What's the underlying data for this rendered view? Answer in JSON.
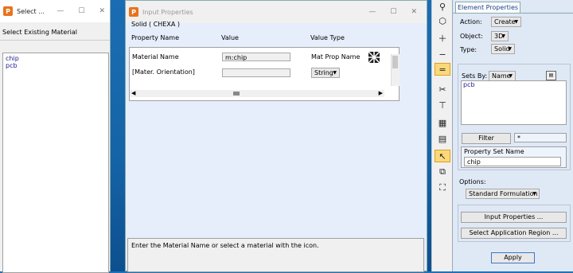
{
  "select_window": {
    "title": "Select ...",
    "instruction": "Select Existing Material",
    "items": [
      "chip",
      "pcb"
    ]
  },
  "input_window": {
    "title": "Input Properties",
    "solid_label": "Solid  ( CHEXA )",
    "col_name": "Property Name",
    "col_value": "Value",
    "col_type": "Value Type",
    "row1_name": "Material Name",
    "row1_value": "m:chip",
    "row1_type": "Mat Prop Name",
    "row2_name": "[Mater. Orientation]",
    "row2_value": "",
    "row2_type": "String",
    "message": "Enter the Material Name or select a material with the icon."
  },
  "element_props": {
    "tab": "Element Properties",
    "action_label": "Action:",
    "action_value": "Create",
    "object_label": "Object:",
    "object_value": "3D",
    "type_label": "Type:",
    "type_value": "Solid",
    "sets_by_label": "Sets By:",
    "sets_by_value": "Name",
    "sets": [
      "pcb"
    ],
    "filter_label": "Filter",
    "filter_value": "*",
    "prop_set_label": "Property Set Name",
    "prop_set_value": "chip",
    "options_label": "Options:",
    "options_value": "Standard Formulation",
    "input_props_btn": "Input Properties ...",
    "select_region_btn": "Select Application Region ...",
    "apply_btn": "Apply"
  },
  "colors": {
    "accent": "#fbd87a",
    "desktop": "#1b6db3",
    "list_text": "#1a1a8a"
  }
}
